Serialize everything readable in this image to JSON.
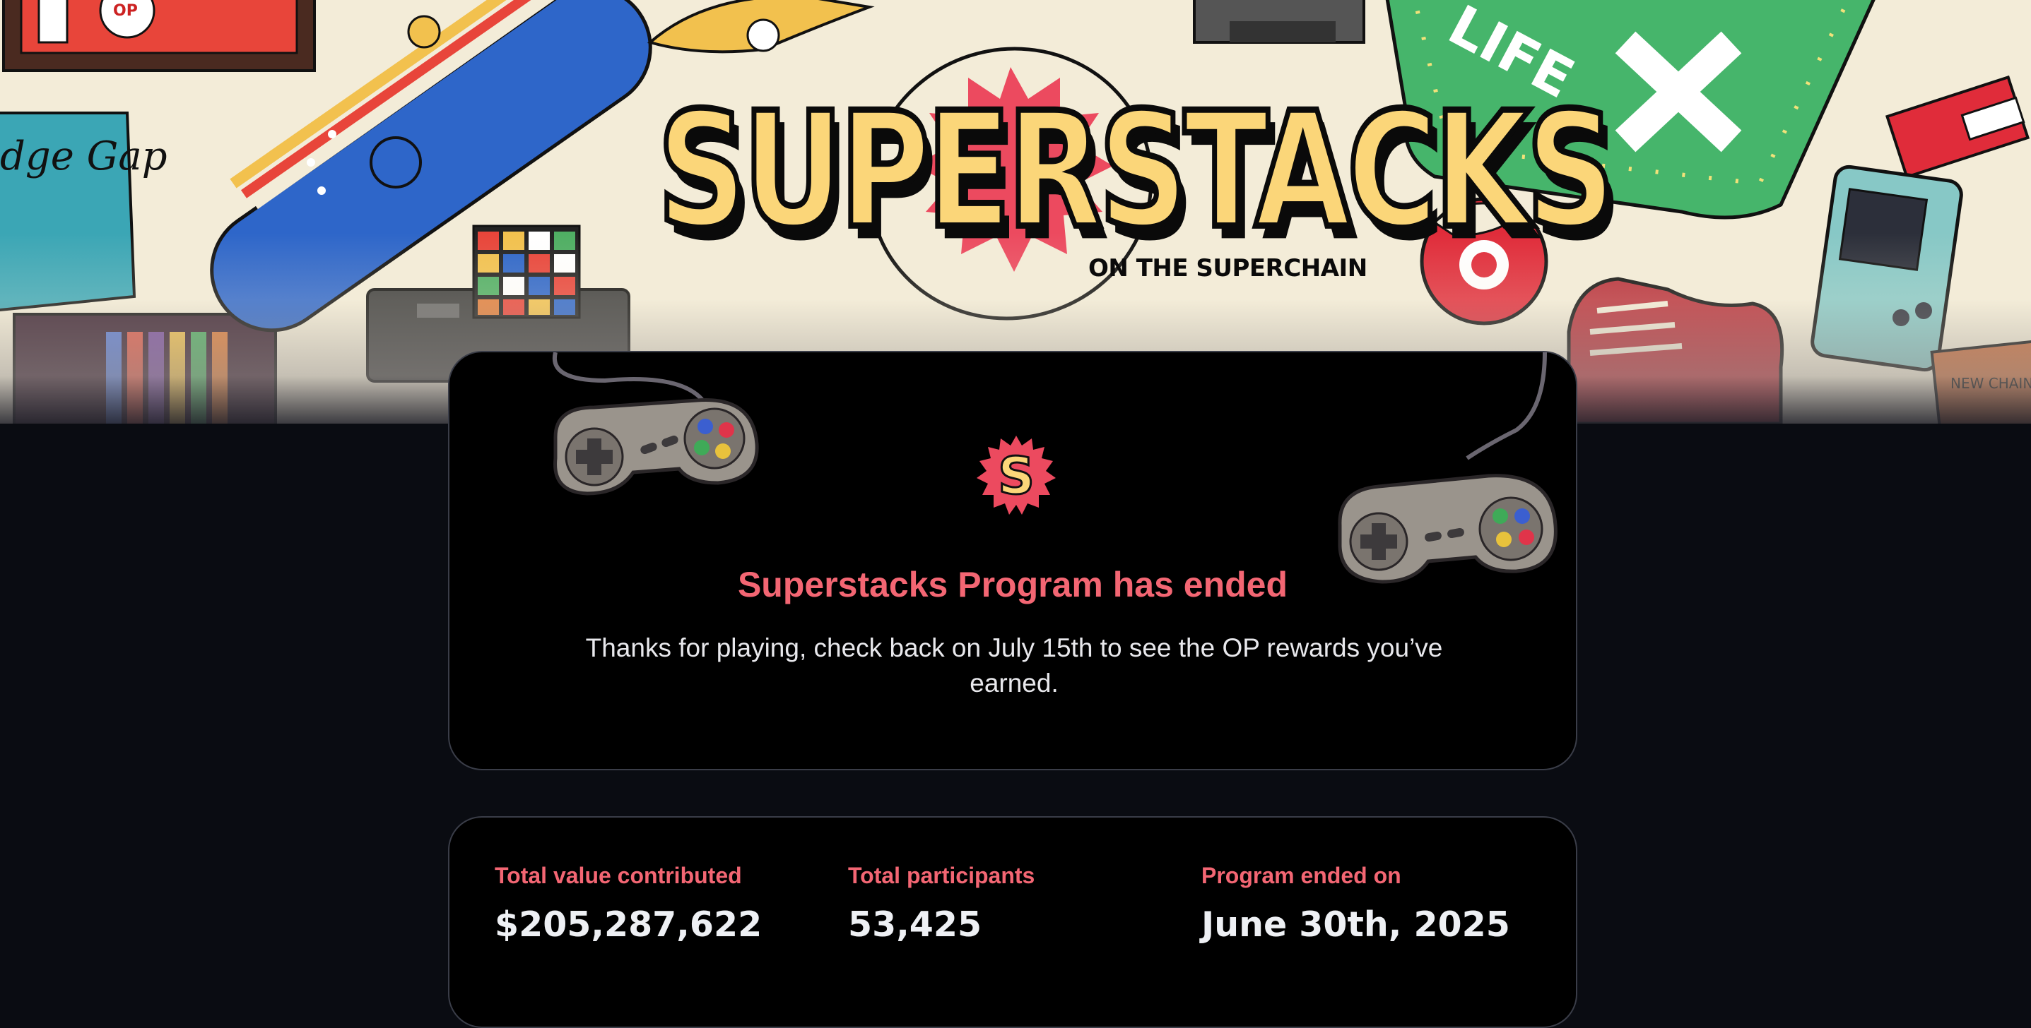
{
  "hero": {
    "logo_title": "SUPERSTACKS",
    "logo_subtitle": "ON THE SUPERCHAIN",
    "art_text": {
      "book_text": "dge Gap",
      "board_text": "LIFE",
      "cassette_text": "NEW CHAIN"
    }
  },
  "status_card": {
    "badge_letter": "S",
    "title": "Superstacks Program has ended",
    "message": "Thanks for playing, check back on July 15th to see the OP rewards you’ve earned."
  },
  "stats": [
    {
      "label": "Total value contributed",
      "value": "$205,287,622"
    },
    {
      "label": "Total participants",
      "value": "53,425"
    },
    {
      "label": "Program ended on",
      "value": "June 30th, 2025"
    }
  ],
  "colors": {
    "accent_red": "#f36673",
    "logo_yellow": "#fbd679",
    "page_background": "#0a0c12",
    "card_background": "#000000"
  }
}
